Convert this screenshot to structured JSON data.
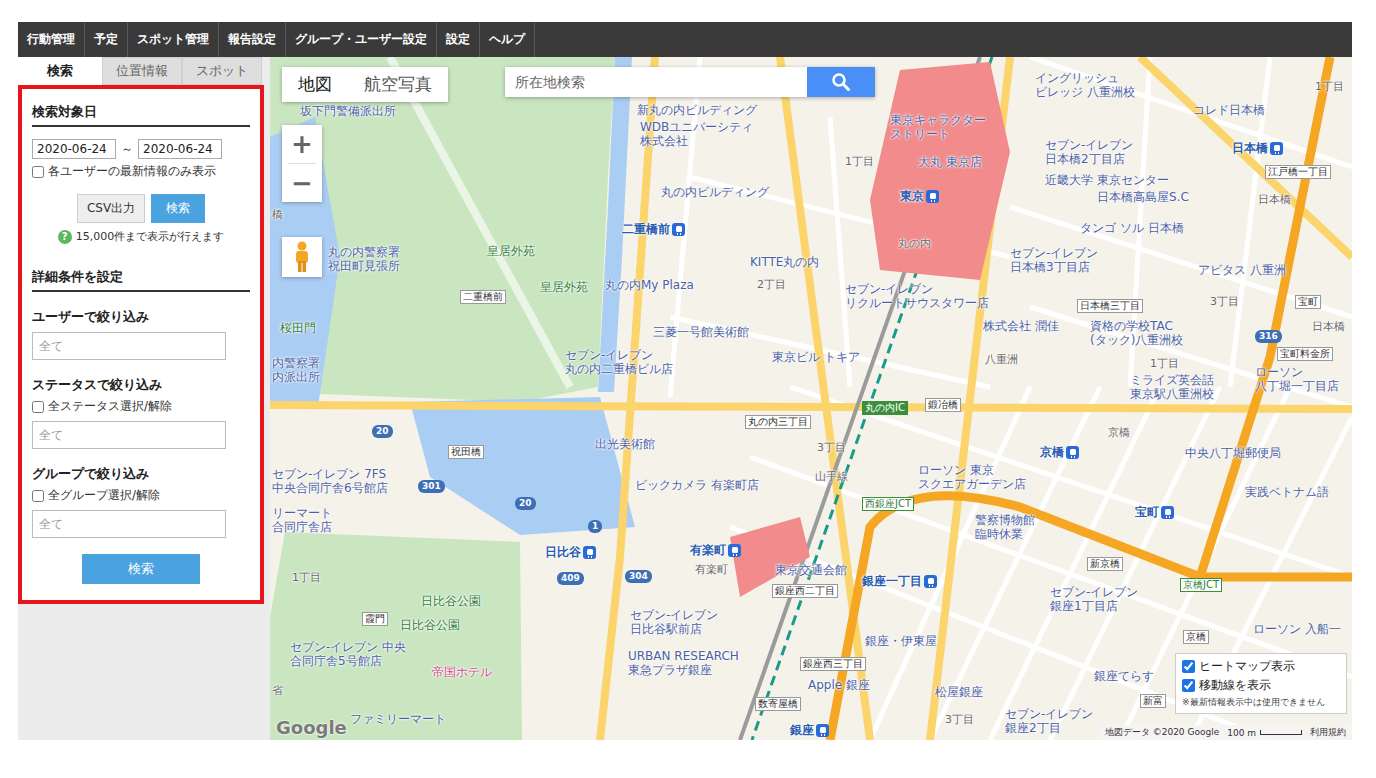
{
  "nav": [
    "行動管理",
    "予定",
    "スポット管理",
    "報告設定",
    "グループ・ユーザー設定",
    "設定",
    "ヘルプ"
  ],
  "side_tabs": [
    {
      "label": "検索",
      "selected": true
    },
    {
      "label": "位置情報",
      "selected": false
    },
    {
      "label": "スポット",
      "selected": false
    }
  ],
  "search_panel": {
    "date_heading": "検索対象日",
    "date_from": "2020-06-24",
    "date_sep": "～",
    "date_to": "2020-06-24",
    "latest_only": {
      "label": "各ユーザーの最新情報のみ表示",
      "checked": false
    },
    "csv_button": "CSV出力",
    "search_button": "検索",
    "help_icon": "?",
    "help_text": "15,000件まで表示が行えます",
    "detail_heading": "詳細条件を設定",
    "filters": [
      {
        "kind": "input",
        "title": "ユーザーで絞り込み",
        "toggle_label": "",
        "toggle_checked": false,
        "placeholder": "全て"
      },
      {
        "kind": "check-input",
        "title": "ステータスで絞り込み",
        "toggle_label": "全ステータス選択/解除",
        "toggle_checked": false,
        "placeholder": "全て"
      },
      {
        "kind": "check-input",
        "title": "グループで絞り込み",
        "toggle_label": "全グループ選択/解除",
        "toggle_checked": false,
        "placeholder": "全て"
      }
    ],
    "submit_button": "検索"
  },
  "map": {
    "type_tabs": [
      {
        "label": "地図",
        "selected": true
      },
      {
        "label": "航空写真",
        "selected": false
      }
    ],
    "search_placeholder": "所在地検索",
    "zoom_in": "+",
    "zoom_out": "−",
    "layers": [
      {
        "label": "ヒートマップ表示",
        "checked": true
      },
      {
        "label": "移動線を表示",
        "checked": true
      }
    ],
    "layers_note": "※最新情報表示中は使用できません",
    "logo": "Google",
    "attribution": {
      "data": "地図データ ©2020 Google",
      "scale": "100 m",
      "terms": "利用規約"
    },
    "labels": [
      {
        "kind": "place",
        "lines": [
          "坂下門警備派出所"
        ]
      },
      {
        "kind": "place",
        "lines": [
          "新丸の内ビルディング"
        ]
      },
      {
        "kind": "place",
        "lines": [
          "WDBユニバーシティ",
          "株式会社"
        ]
      },
      {
        "kind": "place",
        "lines": [
          "丸の内ビルディング"
        ]
      },
      {
        "kind": "station",
        "lines": [
          "二重橋前"
        ]
      },
      {
        "kind": "green",
        "lines": [
          "皇居外苑"
        ]
      },
      {
        "kind": "place",
        "lines": [
          "丸の内警察署",
          "祝田町見張所"
        ]
      },
      {
        "kind": "sign",
        "lines": [
          "二重橋前"
        ]
      },
      {
        "kind": "green",
        "lines": [
          "皇居外苑"
        ]
      },
      {
        "kind": "place",
        "lines": [
          "丸の内My Plaza"
        ]
      },
      {
        "kind": "place",
        "lines": [
          "KITTE丸の内"
        ]
      },
      {
        "kind": "area",
        "lines": [
          "2丁目"
        ]
      },
      {
        "kind": "place",
        "lines": [
          "セブン-イレブン",
          "リクルートサウスタワー店"
        ]
      },
      {
        "kind": "place",
        "lines": [
          "三菱一号館美術館"
        ]
      },
      {
        "kind": "place",
        "lines": [
          "セブン-イレブン",
          "丸の内二重橋ビル店"
        ]
      },
      {
        "kind": "place",
        "lines": [
          "東京ビル トキア"
        ]
      },
      {
        "kind": "green",
        "lines": [
          "桜田門"
        ]
      },
      {
        "kind": "place",
        "lines": [
          "内警察署",
          "内派出所"
        ]
      },
      {
        "kind": "place",
        "lines": [
          "東京キャラクター",
          "ストリート"
        ]
      },
      {
        "kind": "place",
        "lines": [
          "大丸 東京店"
        ]
      },
      {
        "kind": "station",
        "lines": [
          "東京"
        ]
      },
      {
        "kind": "area",
        "lines": [
          "丸の内"
        ]
      },
      {
        "kind": "area",
        "lines": [
          "1丁目"
        ]
      },
      {
        "kind": "place",
        "lines": [
          "イングリッシュ",
          "ビレッジ 八重洲校"
        ]
      },
      {
        "kind": "place",
        "lines": [
          "コレド日本橋"
        ]
      },
      {
        "kind": "place",
        "lines": [
          "セブン-イレブン",
          "日本橋2丁目店"
        ]
      },
      {
        "kind": "station",
        "lines": [
          "日本橋"
        ]
      },
      {
        "kind": "sign",
        "lines": [
          "江戸橋一丁目"
        ]
      },
      {
        "kind": "place",
        "lines": [
          "近畿大学 東京センター"
        ]
      },
      {
        "kind": "place",
        "lines": [
          "日本橋高島屋S.C"
        ]
      },
      {
        "kind": "area",
        "lines": [
          "日本橋"
        ]
      },
      {
        "kind": "place",
        "lines": [
          "タンゴ ソル 日本橋"
        ]
      },
      {
        "kind": "place",
        "lines": [
          "セブン-イレブン",
          "日本橋3丁目店"
        ]
      },
      {
        "kind": "place",
        "lines": [
          "アビタス 八重洲"
        ]
      },
      {
        "kind": "sign",
        "lines": [
          "日本橋三丁目"
        ]
      },
      {
        "kind": "area",
        "lines": [
          "3丁目"
        ]
      },
      {
        "kind": "place",
        "lines": [
          "株式会社 潤佳"
        ]
      },
      {
        "kind": "place",
        "lines": [
          "資格の学校TAC",
          "(タック)八重洲校"
        ]
      },
      {
        "kind": "area",
        "lines": [
          "八重洲"
        ]
      },
      {
        "kind": "area",
        "lines": [
          "1丁目"
        ]
      },
      {
        "kind": "place",
        "lines": [
          "ミライズ英会話",
          "東京駅八重洲校"
        ]
      },
      {
        "kind": "sign",
        "lines": [
          "宝町料金所"
        ]
      },
      {
        "kind": "place",
        "lines": [
          "ローソン",
          "八丁堀一丁目店"
        ]
      },
      {
        "kind": "ic",
        "lines": [
          "丸の内IC"
        ]
      },
      {
        "kind": "sign",
        "lines": [
          "鍛冶橋"
        ]
      },
      {
        "kind": "sign",
        "lines": [
          "丸の内三丁目"
        ]
      },
      {
        "kind": "area",
        "lines": [
          "3丁目"
        ]
      },
      {
        "kind": "station",
        "lines": [
          "京橋"
        ]
      },
      {
        "kind": "area",
        "lines": [
          "京橋"
        ]
      },
      {
        "kind": "place",
        "lines": [
          "中央八丁堀郵便局"
        ]
      },
      {
        "kind": "place",
        "lines": [
          "実践ベトナム語"
        ]
      },
      {
        "kind": "station",
        "lines": [
          "宝町"
        ]
      },
      {
        "kind": "place",
        "lines": [
          "警察博物館",
          "臨時休業"
        ]
      },
      {
        "kind": "place",
        "lines": [
          "ローソン 東京",
          "スクエアガーデン店"
        ]
      },
      {
        "kind": "jct",
        "lines": [
          "西銀座JCT"
        ]
      },
      {
        "kind": "area",
        "lines": [
          "山手線"
        ]
      },
      {
        "kind": "place",
        "lines": [
          "出光美術館"
        ]
      },
      {
        "kind": "place",
        "lines": [
          "ビックカメラ 有楽町店"
        ]
      },
      {
        "kind": "place",
        "lines": [
          "セブン-イレブン 7FS",
          "中央合同庁舎6号館店"
        ]
      },
      {
        "kind": "sign",
        "lines": [
          "祝田橋"
        ]
      },
      {
        "kind": "place",
        "lines": [
          "リーマート",
          "合同庁舎店"
        ]
      },
      {
        "kind": "station",
        "lines": [
          "日比谷"
        ]
      },
      {
        "kind": "station",
        "lines": [
          "有楽町"
        ]
      },
      {
        "kind": "area",
        "lines": [
          "有楽町"
        ]
      },
      {
        "kind": "place",
        "lines": [
          "東京交通会館"
        ]
      },
      {
        "kind": "station",
        "lines": [
          "銀座一丁目"
        ]
      },
      {
        "kind": "sign",
        "lines": [
          "銀座西二丁目"
        ]
      },
      {
        "kind": "sign",
        "lines": [
          "新京橋"
        ]
      },
      {
        "kind": "place",
        "lines": [
          "セブン-イレブン",
          "銀座1丁目店"
        ]
      },
      {
        "kind": "jct",
        "lines": [
          "京橋JCT"
        ]
      },
      {
        "kind": "area",
        "lines": [
          "1丁目"
        ]
      },
      {
        "kind": "sign",
        "lines": [
          "霞門"
        ]
      },
      {
        "kind": "green",
        "lines": [
          "日比谷公園"
        ]
      },
      {
        "kind": "green",
        "lines": [
          "日比谷公園"
        ]
      },
      {
        "kind": "place",
        "lines": [
          "セブン-イレブン 中央",
          "合同庁舎5号館店"
        ]
      },
      {
        "kind": "hotel",
        "lines": [
          "帝国ホテル"
        ]
      },
      {
        "kind": "place",
        "lines": [
          "セブン-イレブン",
          "日比谷駅前店"
        ]
      },
      {
        "kind": "place",
        "lines": [
          "URBAN RESEARCH",
          "東急プラザ銀座"
        ]
      },
      {
        "kind": "place",
        "lines": [
          "銀座・伊東屋"
        ]
      },
      {
        "kind": "sign",
        "lines": [
          "銀座西三丁目"
        ]
      },
      {
        "kind": "place",
        "lines": [
          "Apple 銀座"
        ]
      },
      {
        "kind": "place",
        "lines": [
          "松屋銀座"
        ]
      },
      {
        "kind": "place",
        "lines": [
          "銀座てらす"
        ]
      },
      {
        "kind": "sign",
        "lines": [
          "数寄屋橋"
        ]
      },
      {
        "kind": "area",
        "lines": [
          "3丁目"
        ]
      },
      {
        "kind": "place",
        "lines": [
          "セブン-イレブン",
          "銀座2丁目"
        ]
      },
      {
        "kind": "sign",
        "lines": [
          "京橋"
        ]
      },
      {
        "kind": "place",
        "lines": [
          "ローソン 入船一"
        ]
      },
      {
        "kind": "sign",
        "lines": [
          "新富"
        ]
      },
      {
        "kind": "area",
        "lines": [
          "省"
        ]
      },
      {
        "kind": "place",
        "lines": [
          "ファミリーマート"
        ]
      },
      {
        "kind": "station",
        "lines": [
          "銀座"
        ]
      },
      {
        "kind": "sign",
        "lines": [
          "宝町"
        ]
      },
      {
        "kind": "area",
        "lines": [
          "日本橋"
        ]
      },
      {
        "kind": "area",
        "lines": [
          "1丁目"
        ]
      },
      {
        "kind": "area",
        "lines": [
          "橋"
        ]
      },
      {
        "kind": "shield",
        "lines": [
          "20"
        ]
      },
      {
        "kind": "shield",
        "lines": [
          "301"
        ]
      },
      {
        "kind": "shield",
        "lines": [
          "20"
        ]
      },
      {
        "kind": "shield",
        "lines": [
          "1"
        ]
      },
      {
        "kind": "shield",
        "lines": [
          "409"
        ]
      },
      {
        "kind": "shield",
        "lines": [
          "304"
        ]
      },
      {
        "kind": "shield",
        "lines": [
          "316"
        ]
      }
    ]
  }
}
